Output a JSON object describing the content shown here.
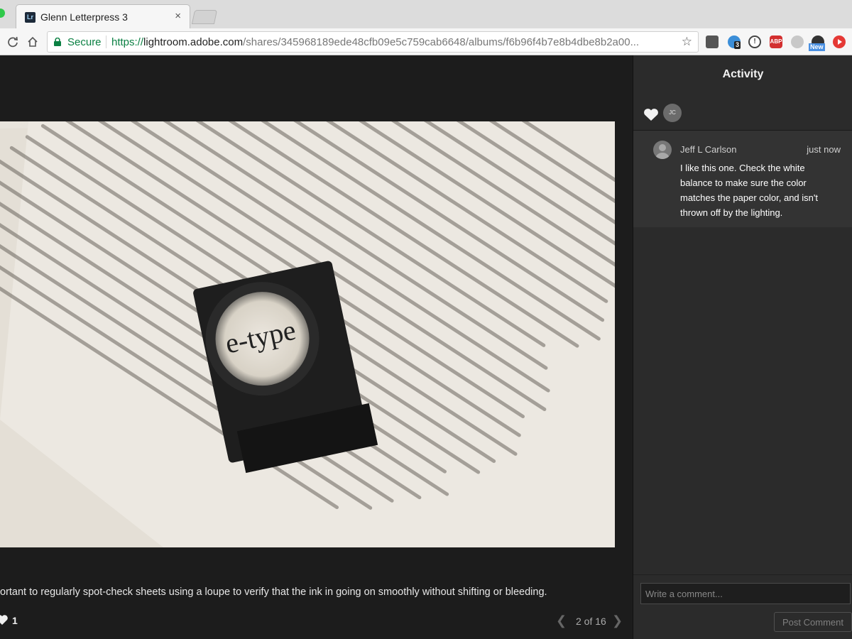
{
  "browser": {
    "tab_title": "Glenn Letterpress 3",
    "tab_favicon_text": "Lr",
    "tab_close": "×",
    "secure_label": "Secure",
    "url_scheme": "https://",
    "url_host": "lightroom.adobe.com",
    "url_path": "/shares/345968189ede48cfb09e5c759cab6648/albums/f6b96f4b7e8b4dbe8b2a00...",
    "star_icon": "☆",
    "ext_badge_count": "3",
    "ext_new_label": "New",
    "ext_abp_label": "ABP"
  },
  "main": {
    "caption": "ortant to regularly spot-check sheets using a loupe to verify that the ink in going on smoothly without shifting or bleeding.",
    "like_count": "1",
    "page_indicator": "2 of 16",
    "photo_lens_text": "e-type"
  },
  "activity": {
    "title": "Activity",
    "liker_initials": "JC",
    "comments": [
      {
        "author": "Jeff L Carlson",
        "time": "just now",
        "body": "I like this one. Check the white balance to make sure the color matches the paper color, and isn't thrown off by the lighting."
      }
    ],
    "input_placeholder": "Write a comment...",
    "post_button_label": "Post Comment"
  },
  "colors": {
    "panel_bg": "#2b2b2b",
    "stage_bg": "#1c1c1c",
    "secure_green": "#0b8043"
  }
}
